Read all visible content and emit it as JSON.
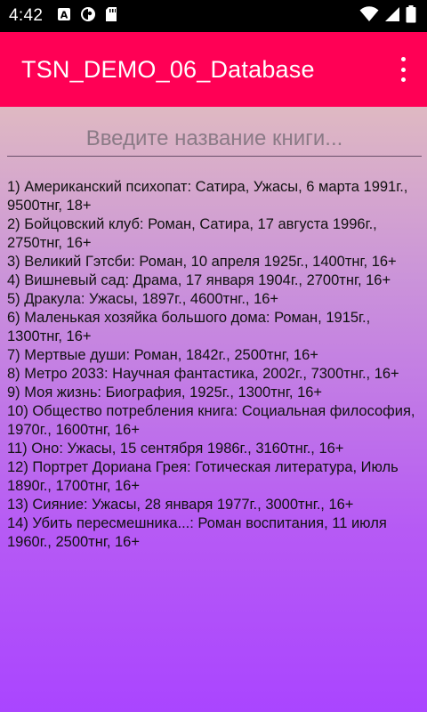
{
  "status_bar": {
    "time": "4:42",
    "icons_left": [
      "font-a-icon",
      "sync-icon",
      "sd-card-icon"
    ],
    "icons_right": [
      "wifi-icon",
      "signal-icon",
      "battery-icon"
    ]
  },
  "app_bar": {
    "title": "TSN_DEMO_06_Database",
    "background": "#ff0055"
  },
  "search": {
    "placeholder": "Введите название книги...",
    "value": ""
  },
  "books": [
    "1) Американский психопат: Сатира, Ужасы, 6 марта 1991г., 9500тнг, 18+",
    "2) Бойцовский клуб: Роман, Сатира, 17 августа 1996г., 2750тнг, 16+",
    "3) Великий Гэтсби: Роман, 10 апреля 1925г., 1400тнг, 16+",
    "4) Вишневый сад: Драма, 17 января 1904г., 2700тнг, 16+",
    "5) Дракула: Ужасы, 1897г., 4600тнг., 16+",
    "6) Маленькая хозяйка большого дома: Роман, 1915г., 1300тнг, 16+",
    "7) Мертвые души: Роман, 1842г., 2500тнг, 16+",
    "8) Метро 2033: Научная фантастика, 2002г., 7300тнг., 16+",
    "9) Моя жизнь: Биография, 1925г., 1300тнг, 16+",
    "10) Общество потребления книга: Социальная философия, 1970г., 1600тнг, 16+",
    "11) Оно: Ужасы, 15 сентября 1986г., 3160тнг., 16+",
    "12) Портрет Дориана Грея: Готическая литература, Июль 1890г., 1700тнг, 16+",
    "13) Сияние: Ужасы, 28 января 1977г., 3000тнг., 16+",
    "14) Убить пересмешника...: Роман воспитания, 11 июля 1960г., 2500тнг, 16+"
  ]
}
